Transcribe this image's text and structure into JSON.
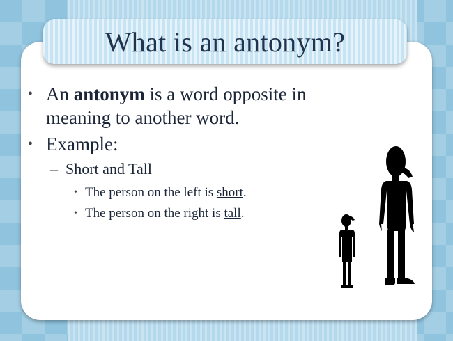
{
  "slide": {
    "title": "What is an antonym?",
    "bullet1": {
      "part1": "An ",
      "bold": "antonym",
      "part2": " is a word opposite in meaning to another word."
    },
    "bullet2": "Example:",
    "sub_bullet": "Short and Tall",
    "sub_sub": [
      {
        "pre": "The person on the left is ",
        "word": "short",
        "post": "."
      },
      {
        "pre": "The person on the right is ",
        "word": "tall",
        "post": "."
      }
    ]
  },
  "colors": {
    "background": "#8fc3de",
    "title_bar": "#c7e4f4",
    "title_text": "#22334e",
    "body_text": "#1b2538",
    "silhouette": "#000000"
  },
  "icons": [
    "short-person-silhouette-icon",
    "tall-person-silhouette-icon"
  ]
}
